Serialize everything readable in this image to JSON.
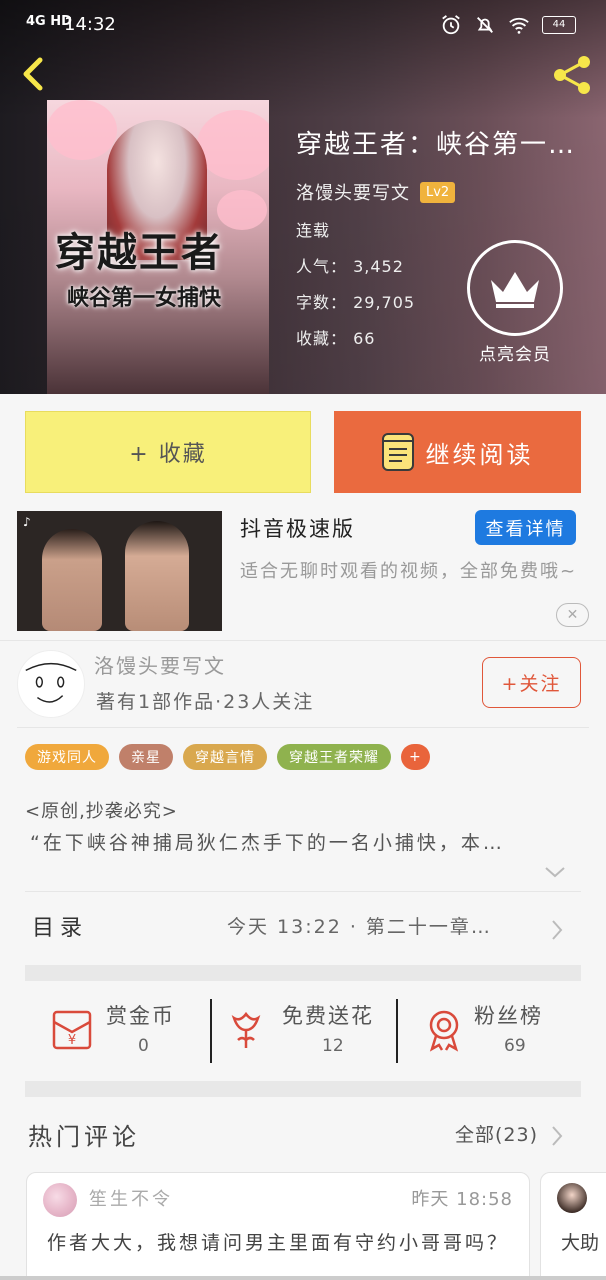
{
  "status_bar": {
    "network": "4G HD",
    "time": "14:32",
    "battery": "44"
  },
  "book": {
    "title": "穿越王者：峡谷第一女捕快",
    "cover_title": "穿越王者",
    "cover_subtitle": "峡谷第一女捕快",
    "author": "洛馒头要写文",
    "level": "Lv2",
    "status": "连载",
    "popularity_label": "人气：",
    "popularity": "3,452",
    "words_label": "字数：",
    "words": "29,705",
    "favorites_label": "收藏：",
    "favorites": "66"
  },
  "vip": {
    "label": "点亮会员"
  },
  "actions": {
    "collect": "+ 收藏",
    "read": "继续阅读"
  },
  "ad": {
    "title": "抖音极速版",
    "button": "查看详情",
    "description": "适合无聊时观看的视频，全部免费哦~",
    "close": "✕"
  },
  "author_card": {
    "name": "洛馒头要写文",
    "meta": "著有1部作品·23人关注",
    "follow": "+关注"
  },
  "tags": [
    {
      "label": "游戏同人",
      "color": "#f0a83c"
    },
    {
      "label": "亲星",
      "color": "#c0806a"
    },
    {
      "label": "穿越言情",
      "color": "#d9a84e"
    },
    {
      "label": "穿越王者荣耀",
      "color": "#8fb24e"
    },
    {
      "label": "+",
      "color": "#e9643b"
    }
  ],
  "intro": {
    "original_note": "<原创,抄袭必究>",
    "text": "“在下峡谷神捕局狄仁杰手下的一名小捕快，本…"
  },
  "catalog": {
    "label": "目录",
    "latest": "今天 13:22 · 第二十一章…"
  },
  "stats": [
    {
      "name": "赏金币",
      "value": "0",
      "icon": "red-envelope-icon"
    },
    {
      "name": "免费送花",
      "value": "12",
      "icon": "flower-icon"
    },
    {
      "name": "粉丝榜",
      "value": "69",
      "icon": "medal-icon"
    }
  ],
  "comments": {
    "title": "热门评论",
    "all": "全部(23)",
    "items": [
      {
        "user": "笙生不令",
        "time": "昨天 18:58",
        "text": "作者大大，我想请问男主里面有守约小哥哥吗？"
      },
      {
        "text": "大助"
      }
    ]
  },
  "colors": {
    "accent_orange": "#ea6a3f",
    "collect_yellow": "#f8f07a",
    "link_blue": "#1e7ae0",
    "follow_red": "#e0573a"
  }
}
